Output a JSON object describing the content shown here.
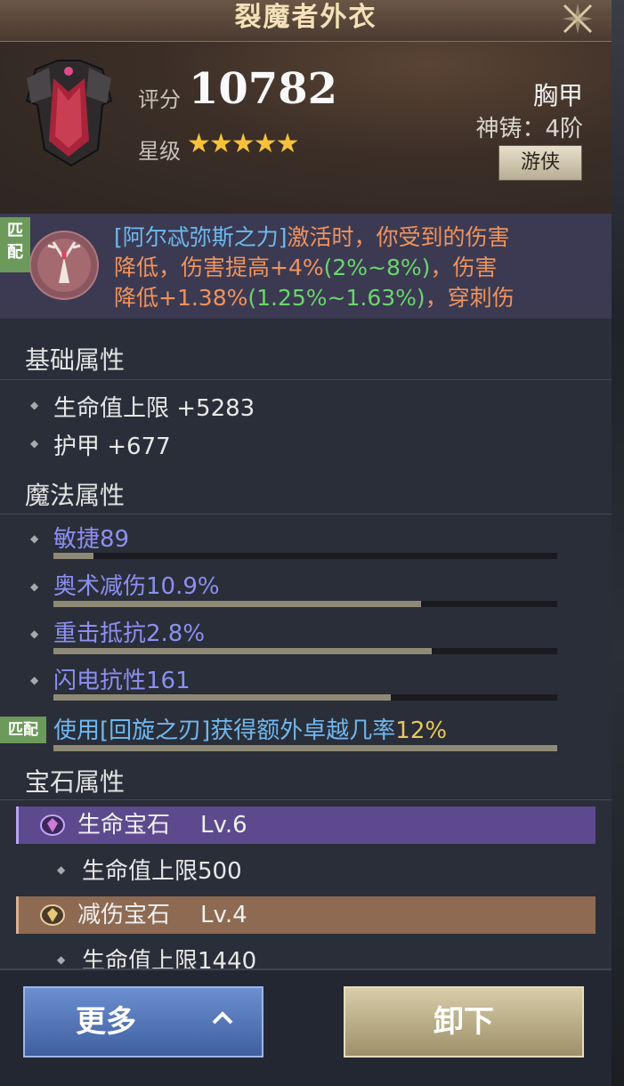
{
  "header": {
    "title": "裂魔者外衣",
    "score_label": "评分",
    "score_value": "10782",
    "star_label": "星级",
    "stars": "★★★★★",
    "star_count": 5,
    "slot": "胸甲",
    "forge": "神铸：4阶",
    "class_button": "游侠"
  },
  "match": {
    "tag": "匹配",
    "name": "[阿尔忒弥斯之力]",
    "text_1": "激活时，你受到的伤害",
    "text_2": "降低，伤害提高+4%",
    "range_1": "(2%~8%)",
    "text_3": "，伤害",
    "text_4": "降低+1.38%",
    "range_2": "(1.25%~1.63%)",
    "text_5": "，穿刺伤"
  },
  "basic": {
    "title": "基础属性",
    "items": [
      "生命值上限 +5283",
      "护甲 +677"
    ]
  },
  "magic": {
    "title": "魔法属性",
    "items": [
      {
        "label": "敏捷89",
        "fill": 0.08
      },
      {
        "label": "奥术减伤10.9%",
        "fill": 0.73
      },
      {
        "label": "重击抵抗2.8%",
        "fill": 0.75
      },
      {
        "label": "闪电抗性161",
        "fill": 0.67
      }
    ],
    "match_tag": "匹配",
    "excellent_text": "使用[回旋之刃]获得额外卓越几率",
    "excellent_value": "12%",
    "excellent_fill": 1.0
  },
  "gems": {
    "title": "宝石属性",
    "list": [
      {
        "name": "生命宝石",
        "level": "Lv.6",
        "attr": "生命值上限500",
        "color": "#5d4a8e"
      },
      {
        "name": "减伤宝石",
        "level": "Lv.4",
        "attr": "生命值上限1440",
        "color": "#8e6a52"
      }
    ]
  },
  "footer": {
    "more": "更多",
    "remove": "卸下"
  },
  "colors": {
    "orange_text": "#f0935c",
    "blue_text": "#6fb8f0",
    "green_text": "#6ad66a",
    "magic_text": "#8d8ff0",
    "star": "#f7c23a"
  }
}
